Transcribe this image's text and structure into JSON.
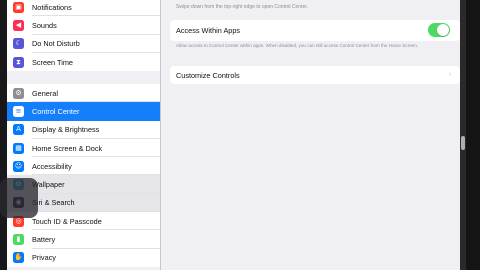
{
  "sidebar": {
    "group1": [
      {
        "label": "Notifications",
        "icon": "notifications-icon",
        "color": "#ff3b30",
        "glyph": "▣",
        "name": "sidebar-item-notifications"
      },
      {
        "label": "Sounds",
        "icon": "speaker-icon",
        "color": "#ff2d55",
        "glyph": "◀",
        "name": "sidebar-item-sounds"
      },
      {
        "label": "Do Not Disturb",
        "icon": "moon-icon",
        "color": "#5856d6",
        "glyph": "☾",
        "name": "sidebar-item-do-not-disturb"
      },
      {
        "label": "Screen Time",
        "icon": "hourglass-icon",
        "color": "#5856d6",
        "glyph": "⧗",
        "name": "sidebar-item-screen-time"
      }
    ],
    "group2": [
      {
        "label": "General",
        "icon": "gear-icon",
        "color": "#8e8e93",
        "glyph": "⚙",
        "name": "sidebar-item-general"
      },
      {
        "label": "Control Center",
        "icon": "toggles-icon",
        "color": "#8e8e93",
        "glyph": "≡",
        "name": "sidebar-item-control-center",
        "selected": true
      },
      {
        "label": "Display & Brightness",
        "icon": "text-size-icon",
        "color": "#007aff",
        "glyph": "A",
        "name": "sidebar-item-display-brightness"
      },
      {
        "label": "Home Screen & Dock",
        "icon": "grid-icon",
        "color": "#007aff",
        "glyph": "▦",
        "name": "sidebar-item-home-screen-dock"
      },
      {
        "label": "Accessibility",
        "icon": "accessibility-icon",
        "color": "#007aff",
        "glyph": "☺",
        "name": "sidebar-item-accessibility"
      },
      {
        "label": "Wallpaper",
        "icon": "wallpaper-icon",
        "color": "#34aadc",
        "glyph": "✿",
        "name": "sidebar-item-wallpaper",
        "highlighted": true
      },
      {
        "label": "Siri & Search",
        "icon": "siri-icon",
        "color": "#2c2c54",
        "glyph": "◉",
        "name": "sidebar-item-siri-search",
        "highlighted": true
      },
      {
        "label": "Touch ID & Passcode",
        "icon": "fingerprint-icon",
        "color": "#ff3b30",
        "glyph": "◎",
        "name": "sidebar-item-touch-id-passcode"
      },
      {
        "label": "Battery",
        "icon": "battery-icon",
        "color": "#4cd964",
        "glyph": "▮",
        "name": "sidebar-item-battery"
      },
      {
        "label": "Privacy",
        "icon": "hand-icon",
        "color": "#007aff",
        "glyph": "✋",
        "name": "sidebar-item-privacy"
      }
    ]
  },
  "detail": {
    "hint": "Swipe down from the top-right edge to open Control Center.",
    "access_label": "Access Within Apps",
    "access_enabled": true,
    "access_footnote": "Allow access to Control Center within apps. When disabled, you can still access Control Center from the Home Screen.",
    "customize_label": "Customize Controls",
    "chevron": "›"
  },
  "colors": {
    "accent": "#147efb",
    "toggle_on": "#4cd964"
  }
}
